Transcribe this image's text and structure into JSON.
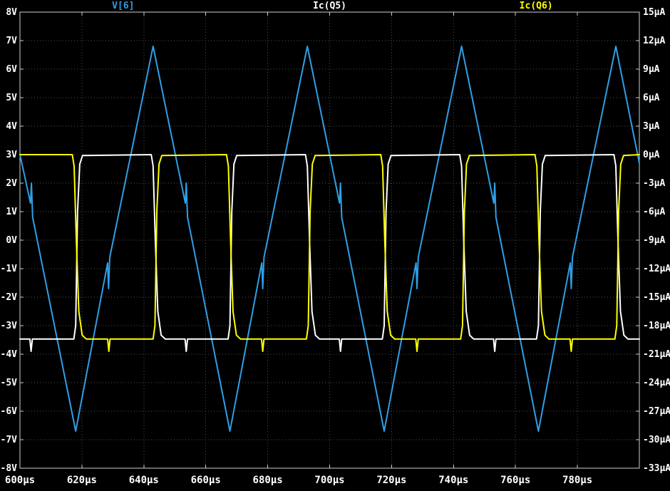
{
  "colors": {
    "background": "#000000",
    "grid": "#4f4f4f",
    "border": "#d0d0d0",
    "tick_text": "#ffffff",
    "trace_v6": "#2f9fe6",
    "trace_icq5": "#ffffff",
    "trace_icq6": "#ffff00"
  },
  "chart_data": {
    "type": "line",
    "title": "",
    "grid": true,
    "legend_position": "top",
    "x_axis": {
      "unit": "µs",
      "min": 600,
      "max": 800,
      "tick_step": 20,
      "tick_labels": [
        "600µs",
        "620µs",
        "640µs",
        "660µs",
        "680µs",
        "700µs",
        "720µs",
        "740µs",
        "760µs",
        "780µs"
      ]
    },
    "y_axis_left": {
      "unit": "V",
      "min": -8,
      "max": 8,
      "tick_step": 1,
      "tick_labels": [
        "8V",
        "7V",
        "6V",
        "5V",
        "4V",
        "3V",
        "2V",
        "1V",
        "0V",
        "-1V",
        "-2V",
        "-3V",
        "-4V",
        "-5V",
        "-6V",
        "-7V",
        "-8V"
      ]
    },
    "y_axis_right": {
      "unit": "µA",
      "min": -33,
      "max": 15,
      "tick_step": 3,
      "tick_labels": [
        "15µA",
        "12µA",
        "9µA",
        "6µA",
        "3µA",
        "0µA",
        "-3µA",
        "-6µA",
        "-9µA",
        "-12µA",
        "-15µA",
        "-18µA",
        "-21µA",
        "-24µA",
        "-27µA",
        "-30µA",
        "-33µA"
      ]
    },
    "series": [
      {
        "name": "V[6]",
        "color": "#2f9fe6",
        "axis": "left",
        "unit": "V",
        "points": [
          [
            600.0,
            3.0
          ],
          [
            603.4,
            1.3
          ],
          [
            603.7,
            2.0
          ],
          [
            604.1,
            0.8
          ],
          [
            618.0,
            -6.7
          ],
          [
            628.3,
            -0.8
          ],
          [
            628.6,
            -1.7
          ],
          [
            629.0,
            -0.6
          ],
          [
            643.0,
            6.8
          ],
          [
            653.4,
            1.3
          ],
          [
            653.7,
            2.0
          ],
          [
            654.1,
            0.8
          ],
          [
            667.8,
            -6.7
          ],
          [
            678.1,
            -0.8
          ],
          [
            678.4,
            -1.7
          ],
          [
            678.8,
            -0.6
          ],
          [
            692.8,
            6.8
          ],
          [
            703.2,
            1.3
          ],
          [
            703.5,
            2.0
          ],
          [
            703.9,
            0.8
          ],
          [
            717.6,
            -6.7
          ],
          [
            727.9,
            -0.8
          ],
          [
            728.2,
            -1.7
          ],
          [
            728.6,
            -0.6
          ],
          [
            742.6,
            6.8
          ],
          [
            753.0,
            1.3
          ],
          [
            753.3,
            2.0
          ],
          [
            753.7,
            0.8
          ],
          [
            767.4,
            -6.7
          ],
          [
            777.7,
            -0.8
          ],
          [
            778.0,
            -1.7
          ],
          [
            778.4,
            -0.6
          ],
          [
            792.4,
            6.8
          ],
          [
            800.0,
            2.7
          ]
        ]
      },
      {
        "name": "Ic(Q5)",
        "color": "#ffffff",
        "axis": "right",
        "unit": "µA",
        "points": [
          [
            600.0,
            -19.4
          ],
          [
            603.2,
            -19.4
          ],
          [
            603.6,
            -20.7
          ],
          [
            604.0,
            -19.4
          ],
          [
            617.4,
            -19.4
          ],
          [
            618.0,
            -18.0
          ],
          [
            618.6,
            -6.0
          ],
          [
            619.3,
            -1.0
          ],
          [
            620.2,
            -0.1
          ],
          [
            642.4,
            0.0
          ],
          [
            643.0,
            -1.2
          ],
          [
            643.7,
            -9.0
          ],
          [
            644.5,
            -16.5
          ],
          [
            645.6,
            -19.0
          ],
          [
            646.9,
            -19.4
          ],
          [
            653.3,
            -19.4
          ],
          [
            653.7,
            -20.7
          ],
          [
            654.1,
            -19.4
          ],
          [
            667.2,
            -19.4
          ],
          [
            667.8,
            -18.0
          ],
          [
            668.4,
            -6.0
          ],
          [
            669.1,
            -1.0
          ],
          [
            670.0,
            -0.1
          ],
          [
            692.2,
            0.0
          ],
          [
            692.8,
            -1.2
          ],
          [
            693.5,
            -9.0
          ],
          [
            694.3,
            -16.5
          ],
          [
            695.4,
            -19.0
          ],
          [
            696.7,
            -19.4
          ],
          [
            703.1,
            -19.4
          ],
          [
            703.5,
            -20.7
          ],
          [
            703.9,
            -19.4
          ],
          [
            717.0,
            -19.4
          ],
          [
            717.6,
            -18.0
          ],
          [
            718.2,
            -6.0
          ],
          [
            718.9,
            -1.0
          ],
          [
            719.8,
            -0.1
          ],
          [
            742.0,
            0.0
          ],
          [
            742.6,
            -1.2
          ],
          [
            743.3,
            -9.0
          ],
          [
            744.1,
            -16.5
          ],
          [
            745.2,
            -19.0
          ],
          [
            746.5,
            -19.4
          ],
          [
            752.9,
            -19.4
          ],
          [
            753.3,
            -20.7
          ],
          [
            753.7,
            -19.4
          ],
          [
            766.8,
            -19.4
          ],
          [
            767.4,
            -18.0
          ],
          [
            768.0,
            -6.0
          ],
          [
            768.7,
            -1.0
          ],
          [
            769.6,
            -0.1
          ],
          [
            791.8,
            0.0
          ],
          [
            792.4,
            -1.2
          ],
          [
            793.1,
            -9.0
          ],
          [
            793.9,
            -16.5
          ],
          [
            795.0,
            -19.0
          ],
          [
            796.3,
            -19.4
          ],
          [
            800.0,
            -19.4
          ]
        ]
      },
      {
        "name": "Ic(Q6)",
        "color": "#ffff00",
        "axis": "right",
        "unit": "µA",
        "points": [
          [
            600.0,
            0.0
          ],
          [
            616.9,
            0.0
          ],
          [
            617.5,
            -1.2
          ],
          [
            618.2,
            -9.0
          ],
          [
            619.0,
            -16.5
          ],
          [
            620.1,
            -19.0
          ],
          [
            621.4,
            -19.4
          ],
          [
            628.3,
            -19.4
          ],
          [
            628.7,
            -20.7
          ],
          [
            629.1,
            -19.4
          ],
          [
            643.0,
            -19.4
          ],
          [
            643.6,
            -18.0
          ],
          [
            644.2,
            -6.0
          ],
          [
            644.9,
            -1.0
          ],
          [
            645.8,
            -0.1
          ],
          [
            666.7,
            0.0
          ],
          [
            667.3,
            -1.2
          ],
          [
            668.0,
            -9.0
          ],
          [
            668.8,
            -16.5
          ],
          [
            669.9,
            -19.0
          ],
          [
            671.2,
            -19.4
          ],
          [
            678.0,
            -19.4
          ],
          [
            678.4,
            -20.7
          ],
          [
            678.8,
            -19.4
          ],
          [
            692.5,
            -19.4
          ],
          [
            693.1,
            -18.0
          ],
          [
            693.7,
            -6.0
          ],
          [
            694.4,
            -1.0
          ],
          [
            695.3,
            -0.1
          ],
          [
            716.5,
            0.0
          ],
          [
            717.1,
            -1.2
          ],
          [
            717.8,
            -9.0
          ],
          [
            718.6,
            -16.5
          ],
          [
            719.7,
            -19.0
          ],
          [
            721.0,
            -19.4
          ],
          [
            727.8,
            -19.4
          ],
          [
            728.2,
            -20.7
          ],
          [
            728.6,
            -19.4
          ],
          [
            742.3,
            -19.4
          ],
          [
            742.9,
            -18.0
          ],
          [
            743.5,
            -6.0
          ],
          [
            744.2,
            -1.0
          ],
          [
            745.1,
            -0.1
          ],
          [
            766.3,
            0.0
          ],
          [
            766.9,
            -1.2
          ],
          [
            767.6,
            -9.0
          ],
          [
            768.4,
            -16.5
          ],
          [
            769.5,
            -19.0
          ],
          [
            770.8,
            -19.4
          ],
          [
            777.6,
            -19.4
          ],
          [
            778.0,
            -20.7
          ],
          [
            778.4,
            -19.4
          ],
          [
            792.1,
            -19.4
          ],
          [
            792.7,
            -18.0
          ],
          [
            793.3,
            -6.0
          ],
          [
            794.0,
            -1.0
          ],
          [
            794.9,
            -0.1
          ],
          [
            800.0,
            0.0
          ]
        ]
      }
    ]
  }
}
